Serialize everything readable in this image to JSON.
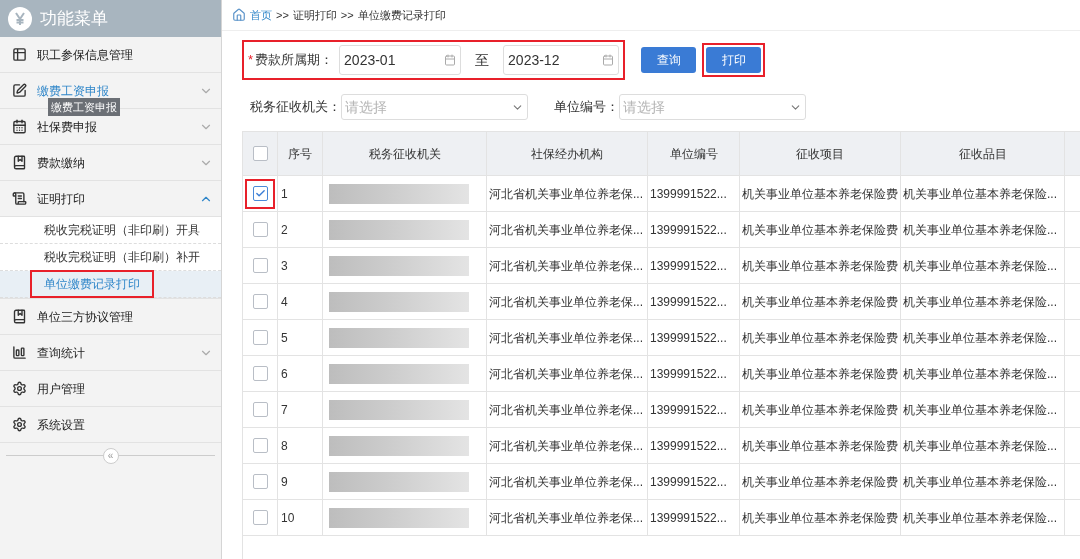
{
  "sidebar": {
    "title": "功能菜单",
    "items": [
      {
        "label": "职工参保信息管理",
        "hovered": false
      },
      {
        "label": "缴费工资申报",
        "hovered": true,
        "expanded": false
      },
      {
        "label": "社保费申报",
        "hovered": false,
        "expanded": false
      },
      {
        "label": "费款缴纳",
        "hovered": false,
        "expanded": false
      },
      {
        "label": "证明打印",
        "hovered": false,
        "expanded": true,
        "children": [
          {
            "label": "税收完税证明（非印刷）开具",
            "selected": false,
            "highlighted": false
          },
          {
            "label": "税收完税证明（非印刷）补开",
            "selected": false,
            "highlighted": false
          },
          {
            "label": "单位缴费记录打印",
            "selected": true,
            "highlighted": true
          }
        ]
      },
      {
        "label": "单位三方协议管理",
        "hovered": false
      },
      {
        "label": "查询统计",
        "hovered": false,
        "expanded": false
      },
      {
        "label": "用户管理",
        "hovered": false
      },
      {
        "label": "系统设置",
        "hovered": false
      }
    ],
    "tooltip": "缴费工资申报",
    "collapse": "«"
  },
  "breadcrumb": {
    "separator": ">>",
    "items": [
      "首页",
      "证明打印",
      "单位缴费记录打印"
    ]
  },
  "period": {
    "label": "费款所属期：",
    "required": "*",
    "from": "2023-01",
    "to_label": "至",
    "to": "2023-12",
    "highlighted": true
  },
  "buttons": [
    {
      "label": "查询",
      "highlighted": false
    },
    {
      "label": "打印",
      "highlighted": true
    }
  ],
  "filters": [
    {
      "label": "税务征收机关：",
      "placeholder": "请选择"
    },
    {
      "label": "单位编号：",
      "placeholder": "请选择"
    }
  ],
  "table": {
    "all_checked": false,
    "columns": [
      "序号",
      "税务征收机关",
      "社保经办机构",
      "单位编号",
      "征收项目",
      "征收品目"
    ],
    "rows": [
      {
        "no": "1",
        "checked": true,
        "highlighted": true,
        "agency": "河北省机关事业单位养老保...",
        "unit": "1399991522...",
        "item": "机关事业单位基本养老保险费",
        "category": "机关事业单位基本养老保险..."
      },
      {
        "no": "2",
        "checked": false,
        "highlighted": false,
        "agency": "河北省机关事业单位养老保...",
        "unit": "1399991522...",
        "item": "机关事业单位基本养老保险费",
        "category": "机关事业单位基本养老保险..."
      },
      {
        "no": "3",
        "checked": false,
        "highlighted": false,
        "agency": "河北省机关事业单位养老保...",
        "unit": "1399991522...",
        "item": "机关事业单位基本养老保险费",
        "category": "机关事业单位基本养老保险..."
      },
      {
        "no": "4",
        "checked": false,
        "highlighted": false,
        "agency": "河北省机关事业单位养老保...",
        "unit": "1399991522...",
        "item": "机关事业单位基本养老保险费",
        "category": "机关事业单位基本养老保险..."
      },
      {
        "no": "5",
        "checked": false,
        "highlighted": false,
        "agency": "河北省机关事业单位养老保...",
        "unit": "1399991522...",
        "item": "机关事业单位基本养老保险费",
        "category": "机关事业单位基本养老保险..."
      },
      {
        "no": "6",
        "checked": false,
        "highlighted": false,
        "agency": "河北省机关事业单位养老保...",
        "unit": "1399991522...",
        "item": "机关事业单位基本养老保险费",
        "category": "机关事业单位基本养老保险..."
      },
      {
        "no": "7",
        "checked": false,
        "highlighted": false,
        "agency": "河北省机关事业单位养老保...",
        "unit": "1399991522...",
        "item": "机关事业单位基本养老保险费",
        "category": "机关事业单位基本养老保险..."
      },
      {
        "no": "8",
        "checked": false,
        "highlighted": false,
        "agency": "河北省机关事业单位养老保...",
        "unit": "1399991522...",
        "item": "机关事业单位基本养老保险费",
        "category": "机关事业单位基本养老保险..."
      },
      {
        "no": "9",
        "checked": false,
        "highlighted": false,
        "agency": "河北省机关事业单位养老保...",
        "unit": "1399991522...",
        "item": "机关事业单位基本养老保险费",
        "category": "机关事业单位基本养老保险..."
      },
      {
        "no": "10",
        "checked": false,
        "highlighted": false,
        "agency": "河北省机关事业单位养老保...",
        "unit": "1399991522...",
        "item": "机关事业单位基本养老保险费",
        "category": "机关事业单位基本养老保险..."
      }
    ]
  }
}
